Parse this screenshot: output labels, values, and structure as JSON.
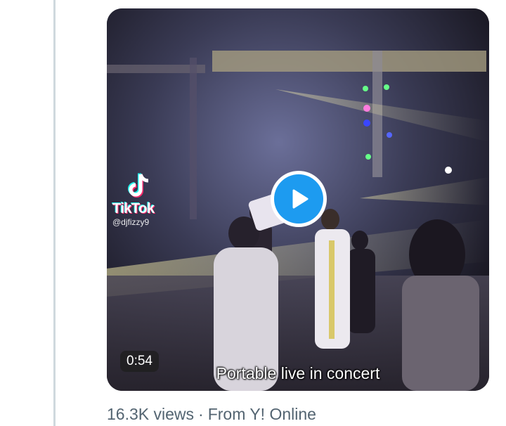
{
  "tweet": {
    "video": {
      "duration": "0:54",
      "caption": "Portable live in concert",
      "watermark": {
        "brand": "TikTok",
        "handle": "@djfizzy9"
      },
      "play_icon": "play-icon"
    },
    "views": "16.3K views",
    "separator": "·",
    "source": "From Y! Online"
  },
  "colors": {
    "accent": "#1d9bf0",
    "meta_text": "#536471",
    "thread_line": "#cfd9de"
  }
}
